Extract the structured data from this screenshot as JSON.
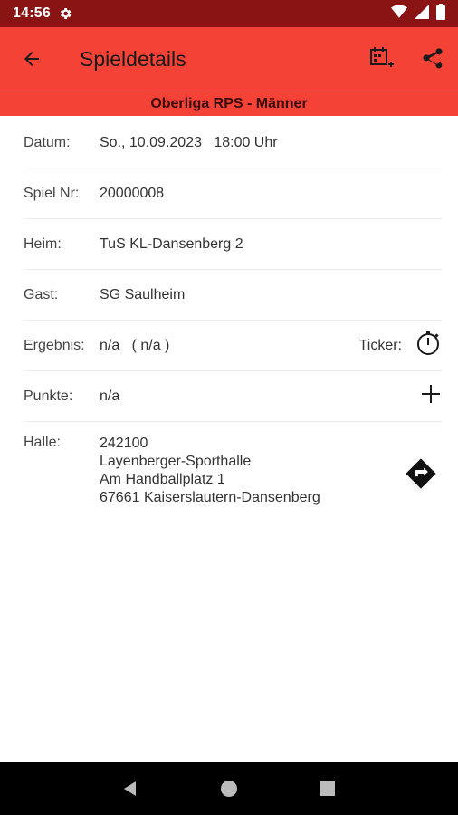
{
  "status_bar": {
    "time": "14:56",
    "icons": [
      "gear-icon",
      "wifi-icon",
      "signal-icon",
      "battery-icon"
    ]
  },
  "app_bar": {
    "title": "Spieldetails",
    "background": "#f44336",
    "actions": [
      "calendar-add-icon",
      "share-icon"
    ]
  },
  "league": "Oberliga RPS - Männer",
  "details": {
    "datum": {
      "label": "Datum:",
      "value": "So., 10.09.2023   18:00 Uhr"
    },
    "spiel_nr": {
      "label": "Spiel Nr:",
      "value": "20000008"
    },
    "heim": {
      "label": "Heim:",
      "value": "TuS KL-Dansenberg 2"
    },
    "gast": {
      "label": "Gast:",
      "value": "SG Saulheim"
    },
    "ergebnis": {
      "label": "Ergebnis:",
      "value": "n/a   ( n/a )",
      "ticker_label": "Ticker:"
    },
    "punkte": {
      "label": "Punkte:",
      "value": "n/a"
    },
    "halle": {
      "label": "Halle:",
      "lines": [
        "242100",
        "Layenberger-Sporthalle",
        "Am Handballplatz 1",
        "67661 Kaiserslautern-Dansenberg"
      ]
    }
  },
  "nav_bar": [
    "back-triangle-icon",
    "home-circle-icon",
    "recents-square-icon"
  ]
}
